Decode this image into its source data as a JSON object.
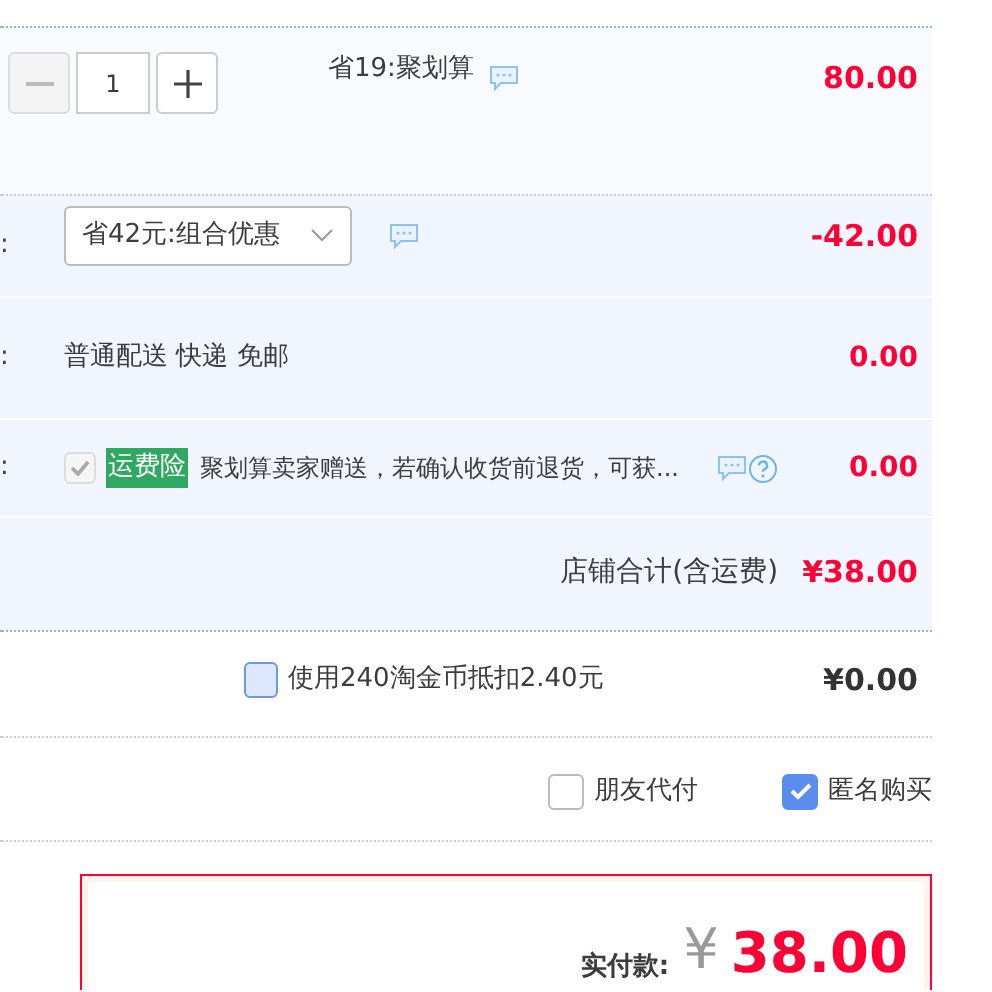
{
  "item": {
    "quantity": "1",
    "minus_disabled": true,
    "promo": "省19:聚划算",
    "price": "80.00"
  },
  "rows": [
    {
      "kind": "select",
      "label": ":",
      "value": "省42元:组合优惠",
      "amount": "-42.00"
    },
    {
      "kind": "text",
      "label": ":",
      "value": "普通配送 快递 免邮",
      "amount": "0.00"
    },
    {
      "kind": "insurance",
      "label": ":",
      "checked": true,
      "disabled": true,
      "tag": "运费险",
      "value": "聚划算卖家赠送，若确认收货前退货，可获...",
      "amount": "0.00"
    }
  ],
  "shop_total": {
    "label": "店铺合计(含运费)",
    "amount": "¥38.00"
  },
  "coins": {
    "checked": false,
    "label": "使用240淘金币抵扣2.40元",
    "amount": "¥0.00"
  },
  "options": [
    {
      "label": "朋友代付",
      "checked": false
    },
    {
      "label": "匿名购买",
      "checked": true
    }
  ],
  "payment": {
    "label": "实付款:",
    "currency": "¥",
    "amount": "38.00"
  }
}
